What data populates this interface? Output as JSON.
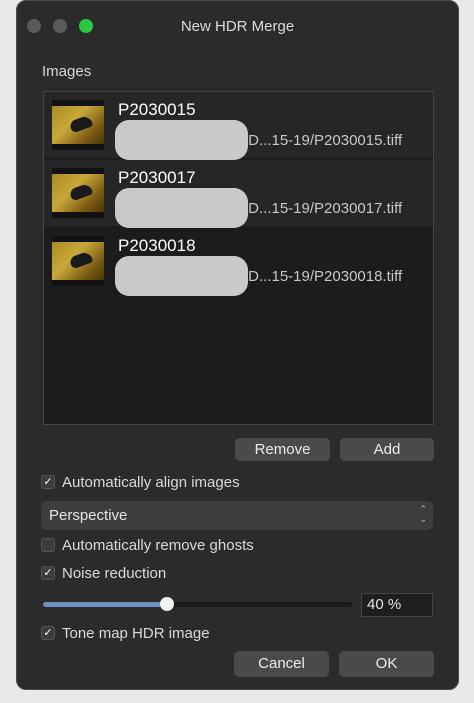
{
  "window": {
    "title": "New HDR Merge"
  },
  "images_label": "Images",
  "images": [
    {
      "name": "P2030015",
      "path": "/D...15-19/P2030015.tiff"
    },
    {
      "name": "P2030017",
      "path": "/D...15-19/P2030017.tiff"
    },
    {
      "name": "P2030018",
      "path": "/D...15-19/P2030018.tiff"
    }
  ],
  "buttons": {
    "remove": "Remove",
    "add": "Add",
    "cancel": "Cancel",
    "ok": "OK"
  },
  "options": {
    "align": {
      "label": "Automatically align images",
      "checked": true
    },
    "align_mode": {
      "value": "Perspective"
    },
    "ghosts": {
      "label": "Automatically remove ghosts",
      "checked": false
    },
    "noise": {
      "label": "Noise reduction",
      "checked": true,
      "value_text": "40 %",
      "value": 0.4
    },
    "tonemap": {
      "label": "Tone map HDR image",
      "checked": true
    }
  },
  "colors": {
    "accent": "#6d8fbf",
    "close_traffic": "#2ac840"
  },
  "icons": {
    "check": "checkmark-icon",
    "select": "up-down-chevron-icon"
  }
}
